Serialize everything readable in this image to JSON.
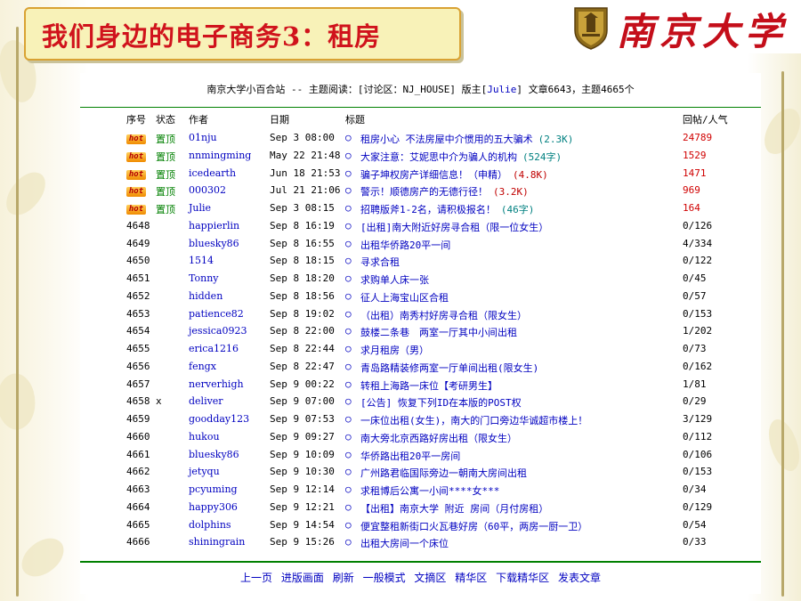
{
  "slide": {
    "title": "我们身边的电子商务3：租房",
    "logo_text": "南京大学",
    "logo_emblem": "university-crest"
  },
  "header": {
    "prefix": "南京大学小百合站 -- 主题阅读：[讨论区：NJ_HOUSE] 版主[",
    "moderator": "Julie",
    "suffix": "] 文章6643，主题4665个"
  },
  "columns": {
    "num": "序号",
    "status": "状态",
    "author": "作者",
    "date": "日期",
    "title": "标题",
    "reply": "回帖/人气"
  },
  "pinned_rows": [
    {
      "author": "01nju",
      "date": "Sep 3 08:00",
      "title": "租房小心 不法房屋中介惯用的五大骗术",
      "size": "(2.3K)",
      "size_color": "teal",
      "reply": "24789"
    },
    {
      "author": "nnmingming",
      "date": "May 22 21:48",
      "title": "大家注意：艾妮思中介为骗人的机构",
      "size": "(524字)",
      "size_color": "teal",
      "reply": "1529"
    },
    {
      "author": "icedearth",
      "date": "Jun 18 21:53",
      "title": "骗子坤权房产详细信息！（申精）",
      "size": "(4.8K)",
      "size_color": "red",
      "reply": "1471"
    },
    {
      "author": "000302",
      "date": "Jul 21 21:06",
      "title": "警示！顺德房产的无德行径！",
      "size": "(3.2K)",
      "size_color": "red",
      "reply": "969"
    },
    {
      "author": "Julie",
      "date": "Sep 3 08:15",
      "title": "招聘版斧1-2名，请积极报名！",
      "size": "(46字)",
      "size_color": "teal",
      "reply": "164"
    }
  ],
  "hot_badge": "hot",
  "pinned_label": "置顶",
  "bullet": "○",
  "rows": [
    {
      "num": "4648",
      "status": "",
      "author": "happierlin",
      "date": "Sep 8 16:19",
      "title": "[出租]南大附近好房寻合租（限一位女生）",
      "reply": "0/126"
    },
    {
      "num": "4649",
      "status": "",
      "author": "bluesky86",
      "date": "Sep 8 16:55",
      "title": "出租华侨路20平一间",
      "reply": "4/334"
    },
    {
      "num": "4650",
      "status": "",
      "author": "1514",
      "date": "Sep 8 18:15",
      "title": "寻求合租",
      "reply": "0/122"
    },
    {
      "num": "4651",
      "status": "",
      "author": "Tonny",
      "date": "Sep 8 18:20",
      "title": "求购单人床一张",
      "reply": "0/45"
    },
    {
      "num": "4652",
      "status": "",
      "author": "hidden",
      "date": "Sep 8 18:56",
      "title": "征人上海宝山区合租",
      "reply": "0/57"
    },
    {
      "num": "4653",
      "status": "",
      "author": "patience82",
      "date": "Sep 8 19:02",
      "title": "（出租）南秀村好房寻合租（限女生）",
      "reply": "0/153"
    },
    {
      "num": "4654",
      "status": "",
      "author": "jessica0923",
      "date": "Sep 8 22:00",
      "title": "鼓楼二条巷　两室一厅其中小间出租",
      "reply": "1/202"
    },
    {
      "num": "4655",
      "status": "",
      "author": "erica1216",
      "date": "Sep 8 22:44",
      "title": "求月租房（男）",
      "reply": "0/73"
    },
    {
      "num": "4656",
      "status": "",
      "author": "fengx",
      "date": "Sep 8 22:47",
      "title": "青岛路精装修两室一厅单间出租(限女生)",
      "reply": "0/162"
    },
    {
      "num": "4657",
      "status": "",
      "author": "nerverhigh",
      "date": "Sep 9 00:22",
      "title": "转租上海路一床位【考研男生】",
      "reply": "1/81"
    },
    {
      "num": "4658",
      "status": "x",
      "author": "deliver",
      "date": "Sep 9 07:00",
      "title": "[公告] 恢复下列ID在本版的POST权",
      "reply": "0/29"
    },
    {
      "num": "4659",
      "status": "",
      "author": "goodday123",
      "date": "Sep 9 07:53",
      "title": "一床位出租(女生)，南大的门口旁边华诚超市楼上！",
      "reply": "3/129"
    },
    {
      "num": "4660",
      "status": "",
      "author": "hukou",
      "date": "Sep 9 09:27",
      "title": "南大旁北京西路好房出租（限女生）",
      "reply": "0/112"
    },
    {
      "num": "4661",
      "status": "",
      "author": "bluesky86",
      "date": "Sep 9 10:09",
      "title": "华侨路出租20平一房间",
      "reply": "0/106"
    },
    {
      "num": "4662",
      "status": "",
      "author": "jetyqu",
      "date": "Sep 9 10:30",
      "title": "广州路君临国际旁边一朝南大房间出租",
      "reply": "0/153"
    },
    {
      "num": "4663",
      "status": "",
      "author": "pcyuming",
      "date": "Sep 9 12:14",
      "title": "求租博后公寓一小间****女***",
      "reply": "0/34"
    },
    {
      "num": "4664",
      "status": "",
      "author": "happy306",
      "date": "Sep 9 12:21",
      "title": "【出租】南京大学 附近 房间（月付房租）",
      "reply": "0/129"
    },
    {
      "num": "4665",
      "status": "",
      "author": "dolphins",
      "date": "Sep 9 14:54",
      "title": "便宜整租新街口火瓦巷好房（60平，两房一厨一卫）",
      "reply": "0/54"
    },
    {
      "num": "4666",
      "status": "",
      "author": "shiningrain",
      "date": "Sep 9 15:26",
      "title": "出租大房间一个床位",
      "reply": "0/33"
    }
  ],
  "footer": {
    "prev": "上一页",
    "enter_board": "进版画面",
    "refresh": "刷新",
    "normal_mode": "一般模式",
    "digest": "文摘区",
    "essence": "精华区",
    "download_essence": "下载精华区",
    "post": "发表文章"
  },
  "colors": {
    "title_red": "#d0131c",
    "link_blue": "#0000c0",
    "pinned_green": "#008000",
    "reply_red": "#d00000",
    "rule_green": "#008000"
  }
}
